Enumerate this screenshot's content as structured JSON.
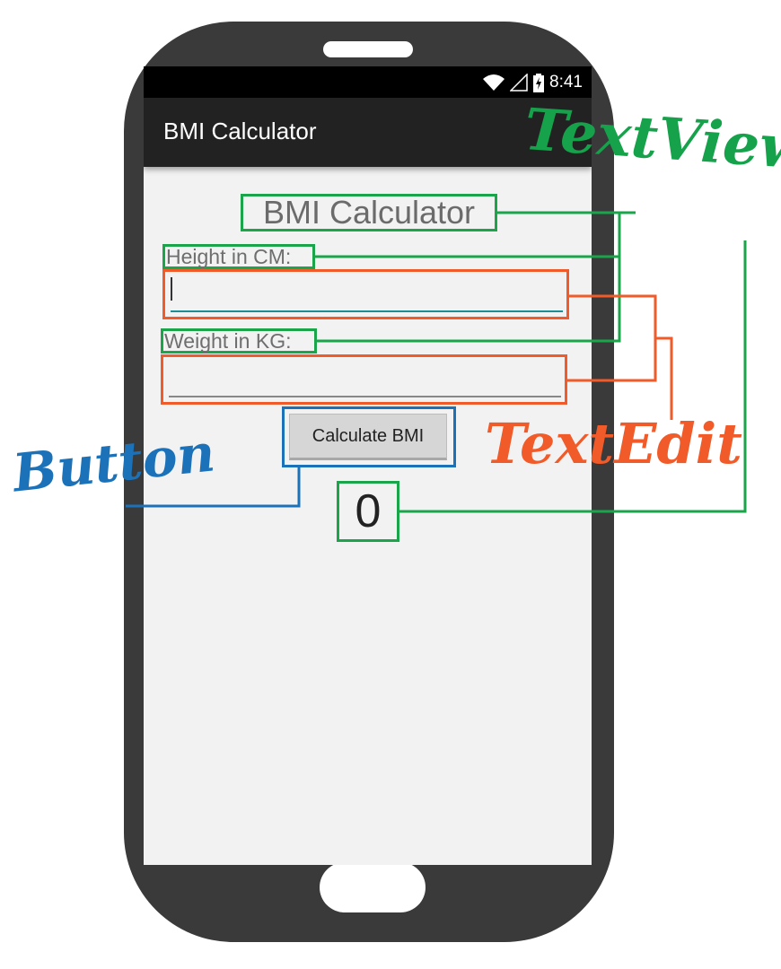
{
  "status_bar": {
    "time": "8:41"
  },
  "app_bar": {
    "title": "BMI Calculator"
  },
  "form": {
    "heading": "BMI Calculator",
    "height_label": "Height in CM:",
    "height_value": "",
    "weight_label": "Weight in KG:",
    "weight_value": "",
    "button_label": "Calculate BMI",
    "result": "0"
  },
  "annotations": {
    "textview": "TextView",
    "textedit": "TextEdit",
    "button": "Button"
  },
  "colors": {
    "textview": "#1aa54a",
    "textedit": "#f15a29",
    "button": "#1c72b8",
    "phone_body": "#3a3a3a",
    "app_bar": "#222222",
    "screen_bg": "#f2f2f2"
  },
  "icons": [
    "wifi-icon",
    "signal-icon",
    "battery-charging-icon"
  ]
}
